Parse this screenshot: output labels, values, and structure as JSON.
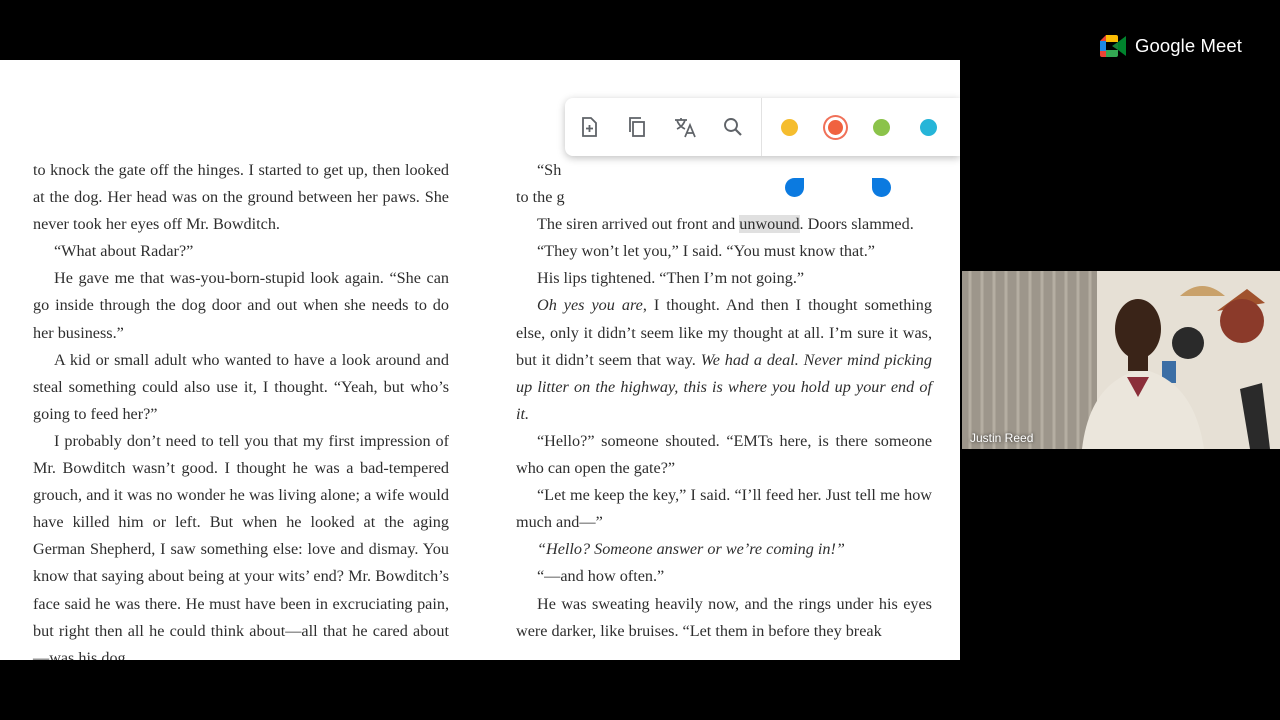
{
  "app": {
    "name": "Google Meet"
  },
  "book": {
    "left_page": [
      {
        "indent": false,
        "segments": [
          {
            "t": "to knock the gate off the hinges. I started to get up, then looked at the dog. Her head was on the ground between her paws. She never took her eyes off Mr. Bowditch."
          }
        ]
      },
      {
        "indent": true,
        "segments": [
          {
            "t": "“What about Radar?”"
          }
        ]
      },
      {
        "indent": true,
        "segments": [
          {
            "t": "He gave me that was-you-born-stupid look again. “She can go inside through the dog door and out when she needs to do her business.”"
          }
        ]
      },
      {
        "indent": true,
        "segments": [
          {
            "t": "A kid or small adult who wanted to have a look around and steal something could also use it, I thought. “Yeah, but who’s going to feed her?”"
          }
        ]
      },
      {
        "indent": true,
        "segments": [
          {
            "t": "I probably don’t need to tell you that my first impression of Mr. Bowditch wasn’t good. I thought he was a bad-tempered grouch, and it was no wonder he was living alone; a wife would have killed him or left. But when he looked at the aging German Shepherd, I saw something else: love and dismay. You know that saying about being at your wits’ end? Mr. Bowditch’s face said he was there. He must have been in excruciating pain, but right then all he could think about—all that he cared about—was his dog."
          }
        ]
      }
    ],
    "right_page": [
      {
        "indent": true,
        "segments": [
          {
            "t": "“Sh"
          }
        ]
      },
      {
        "indent": false,
        "segments": [
          {
            "t": "to the g"
          }
        ]
      },
      {
        "indent": true,
        "segments": [
          {
            "t": "The siren arrived out front and "
          },
          {
            "t": "unwound",
            "hl": true
          },
          {
            "t": ". Doors slammed."
          }
        ]
      },
      {
        "indent": true,
        "segments": [
          {
            "t": "“They won’t let you,” I said. “You must know that.”"
          }
        ]
      },
      {
        "indent": true,
        "segments": [
          {
            "t": "His lips tightened. “Then I’m not going.”"
          }
        ]
      },
      {
        "indent": true,
        "segments": [
          {
            "t": "Oh yes you are",
            "it": true
          },
          {
            "t": ", I thought. And then I thought something else, only it didn’t seem like my thought at all. I’m sure it was, but it didn’t seem that way. "
          },
          {
            "t": "We had a deal. Never mind picking up litter on the highway, this is where you hold up your end of it.",
            "it": true
          }
        ]
      },
      {
        "indent": true,
        "segments": [
          {
            "t": "“Hello?” someone shouted. “EMTs here, is there someone who can open the gate?”"
          }
        ]
      },
      {
        "indent": true,
        "segments": [
          {
            "t": "“Let me keep the key,” I said. “I’ll feed her. Just tell me how much and—”"
          }
        ]
      },
      {
        "indent": true,
        "segments": [
          {
            "t": "“Hello? Someone answer or we’re coming in!”",
            "it": true
          }
        ]
      },
      {
        "indent": true,
        "segments": [
          {
            "t": "“—and how often.”"
          }
        ]
      },
      {
        "indent": true,
        "segments": [
          {
            "t": "He was sweating heavily now, and the rings under his eyes were darker, like bruises. “Let them in before they break"
          }
        ]
      }
    ]
  },
  "selection_toolbar": {
    "actions": [
      {
        "name": "add-note-icon"
      },
      {
        "name": "copy-icon"
      },
      {
        "name": "translate-icon"
      },
      {
        "name": "search-icon"
      }
    ],
    "highlight_colors": [
      {
        "name": "yellow",
        "color": "#f5bd2e",
        "selected": false
      },
      {
        "name": "red",
        "color": "#f0623f",
        "selected": true
      },
      {
        "name": "green",
        "color": "#8bc34a",
        "selected": false
      },
      {
        "name": "blue",
        "color": "#26b5d8",
        "selected": false
      }
    ]
  },
  "participant": {
    "name": "Justin Reed"
  }
}
